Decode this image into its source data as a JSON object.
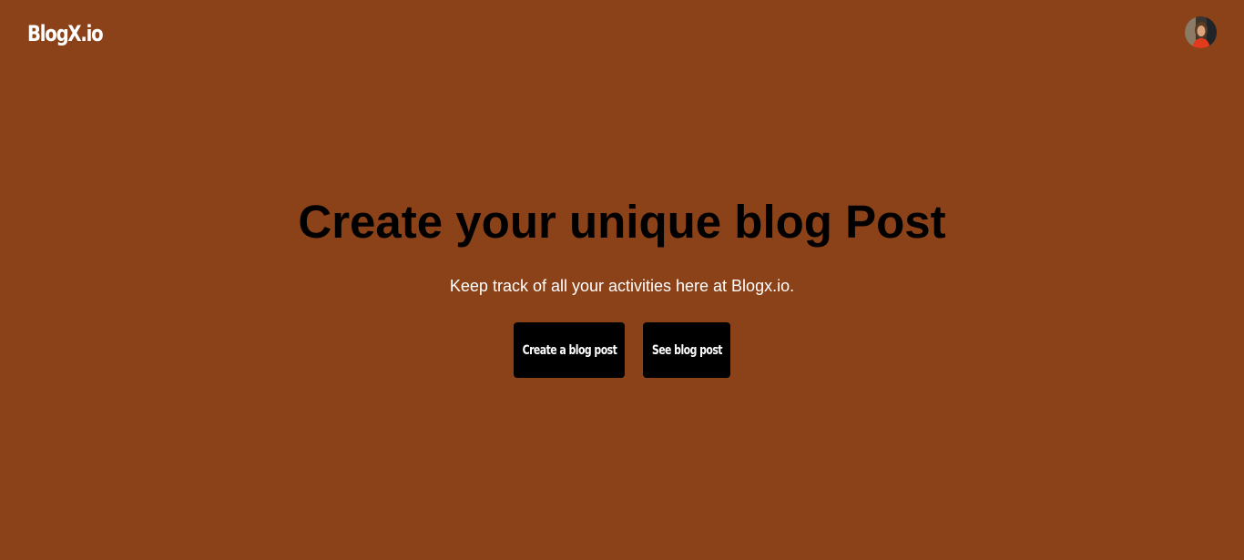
{
  "navbar": {
    "logo": "BlogX.io",
    "avatar_icon": "user-avatar-icon"
  },
  "hero": {
    "title": "Create your unique blog Post",
    "subtitle": "Keep track of all your activities here at Blogx.io.",
    "create_button_label": "Create a blog post",
    "see_button_label": "See blog post"
  },
  "colors": {
    "background": "#8B4219",
    "title": "#000000",
    "subtitle": "#ffffff",
    "button_bg": "#000000",
    "button_text": "#ffffff"
  }
}
